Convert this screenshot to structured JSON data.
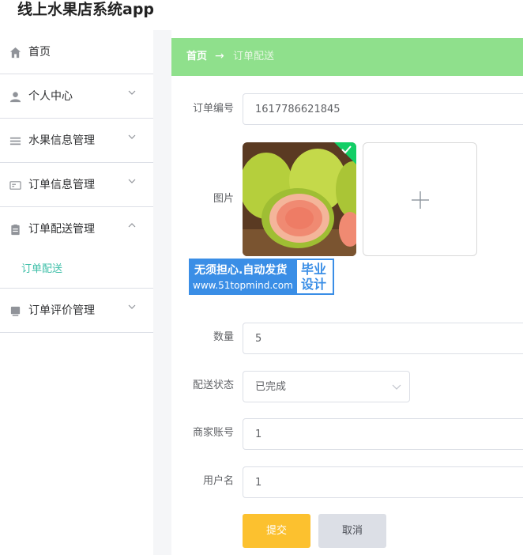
{
  "app": {
    "title": "线上水果店系统app"
  },
  "sidebar": {
    "items": [
      {
        "label": "首页",
        "icon": "home-icon",
        "expanded": false
      },
      {
        "label": "个人中心",
        "icon": "user-icon",
        "expanded": false
      },
      {
        "label": "水果信息管理",
        "icon": "list-icon",
        "expanded": false
      },
      {
        "label": "订单信息管理",
        "icon": "card-icon",
        "expanded": false
      },
      {
        "label": "订单配送管理",
        "icon": "clipboard-icon",
        "expanded": true
      },
      {
        "label": "订单评价管理",
        "icon": "monitor-icon",
        "expanded": false
      }
    ],
    "submenu": {
      "label": "订单配送"
    }
  },
  "breadcrumb": {
    "home": "首页",
    "arrow": "→",
    "current": "订单配送"
  },
  "form": {
    "order_no": {
      "label": "订单编号",
      "value": "1617786621845"
    },
    "image": {
      "label": "图片"
    },
    "quantity": {
      "label": "数量",
      "value": "5"
    },
    "delivery_status": {
      "label": "配送状态",
      "value": "已完成"
    },
    "merchant_account": {
      "label": "商家账号",
      "value": "1"
    },
    "username": {
      "label": "用户名",
      "value": "1"
    }
  },
  "watermark": {
    "line1": "无须担心.自动发货",
    "line2": "www.51topmind.com",
    "right_top": "毕业",
    "right_bottom": "设计"
  },
  "buttons": {
    "submit": "提交",
    "cancel": "取消"
  },
  "colors": {
    "accent": "#3ebfa8",
    "breadcrumb_bg": "#8fe08c",
    "submit": "#fcc12f",
    "cancel": "#dcdfe6",
    "watermark": "#3a8ee6"
  }
}
